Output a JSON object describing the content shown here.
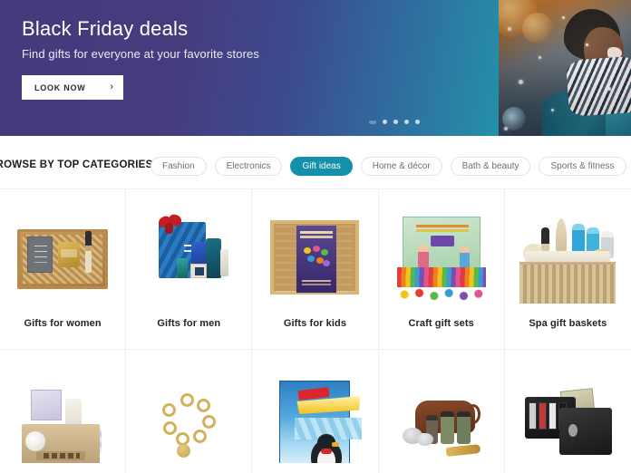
{
  "hero": {
    "title": "Black Friday deals",
    "subtitle": "Find gifts for everyone at your favorite stores",
    "cta_label": "LOOK NOW",
    "cta_chevron": "›",
    "gradient_start": "#45397b",
    "gradient_end": "#2bb3ae",
    "photo_alt": "winter-photo",
    "carousel": {
      "count": 5,
      "active_index": 0
    }
  },
  "categories": {
    "label": "BROWSE BY TOP CATEGORIES",
    "active_color": "#1590ab",
    "pills": [
      {
        "label": "Fashion",
        "active": false
      },
      {
        "label": "Electronics",
        "active": false
      },
      {
        "label": "Gift ideas",
        "active": true
      },
      {
        "label": "Home & décor",
        "active": false
      },
      {
        "label": "Bath & beauty",
        "active": false
      },
      {
        "label": "Sports & fitness",
        "active": false
      }
    ]
  },
  "grid": {
    "rows": [
      {
        "cells": [
          {
            "label": "Gifts for women",
            "art": "gift-box-women"
          },
          {
            "label": "Gifts for men",
            "art": "gift-box-men"
          },
          {
            "label": "Gifts for kids",
            "art": "butterfly-craft-kit"
          },
          {
            "label": "Craft gift sets",
            "art": "craft-supply-box"
          },
          {
            "label": "Spa gift baskets",
            "art": "spa-basket"
          }
        ]
      },
      {
        "cells": [
          {
            "label": "",
            "art": "fresh-gift-basket"
          },
          {
            "label": "",
            "art": "gold-bracelet"
          },
          {
            "label": "",
            "art": "penguin-pile-up-game"
          },
          {
            "label": "",
            "art": "grooming-dopp-kit"
          },
          {
            "label": "",
            "art": "leather-wallet"
          }
        ]
      }
    ]
  }
}
